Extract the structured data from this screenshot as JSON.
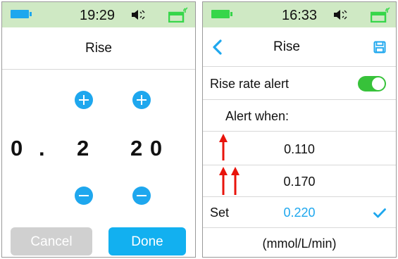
{
  "left_screen": {
    "status_time": "19:29",
    "title": "Rise",
    "digits": {
      "units": "0",
      "dot": ".",
      "tenths": "2",
      "hundredths": "2 0"
    },
    "cancel_label": "Cancel",
    "done_label": "Done"
  },
  "right_screen": {
    "status_time": "16:33",
    "title": "Rise",
    "rows": {
      "toggle_label": "Rise rate alert",
      "toggle_on": true,
      "alert_when_label": "Alert when:",
      "single_arrow_value": "0.110",
      "double_arrow_value": "0.170",
      "set_label": "Set",
      "set_value": "0.220",
      "unit_label": "(mmol/L/min)"
    }
  },
  "colors": {
    "status_bar": "#cfe9c4",
    "accent_blue": "#1ea7ee",
    "button_blue": "#12b0f0",
    "disabled_gray": "#d0d0d0",
    "toggle_green": "#37c23a",
    "arrow_red": "#e8140c"
  },
  "icons": {
    "battery": "battery-icon",
    "speaker": "speaker-icon",
    "phone": "phone-icon",
    "back": "back-chevron-icon",
    "save": "save-icon",
    "check": "checkmark-icon",
    "arrow_up": "red-arrow-up-icon"
  }
}
